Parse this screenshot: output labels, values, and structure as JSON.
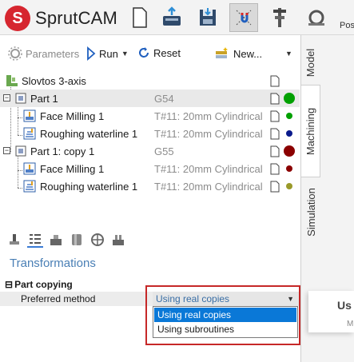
{
  "app": {
    "logo_letter": "S",
    "title": "SprutCAM"
  },
  "toolbar": {
    "icons": [
      "new-document-icon",
      "open-disk-icon",
      "save-icon",
      "magnet-snap-icon",
      "caliper-icon",
      "measure-icon"
    ],
    "pos_label": "Pos"
  },
  "commands": {
    "parameters": "Parameters",
    "run": "Run",
    "reset": "Reset",
    "new": "New..."
  },
  "tree": {
    "root": {
      "name": "Slovtos 3-axis"
    },
    "items": [
      {
        "name": "Part 1",
        "info": "G54",
        "dot_color": "#00a000"
      },
      {
        "name": "Face Milling 1",
        "info": "T#11: 20mm Cylindrical",
        "dot_color": "#00a000"
      },
      {
        "name": "Roughing waterline 1",
        "info": "T#11: 20mm Cylindrical",
        "dot_color": "#0a1a8c"
      },
      {
        "name": "Part 1: copy 1",
        "info": "G55",
        "dot_color": "#8b0000"
      },
      {
        "name": "Face Milling 1",
        "info": "T#11: 20mm Cylindrical",
        "dot_color": "#8b0000"
      },
      {
        "name": "Roughing waterline 1",
        "info": "T#11: 20mm Cylindrical",
        "dot_color": "#9a9a2a"
      }
    ]
  },
  "side_tabs": [
    "Model",
    "Machining",
    "Simulation"
  ],
  "properties": {
    "title": "Transformations",
    "section_toggle": "⊟",
    "section": "Part copying",
    "preferred_label": "Preferred method",
    "selected_value": "Using real copies",
    "options": [
      "Using real copies",
      "Using subroutines"
    ]
  },
  "float_panel": {
    "text1": "Us",
    "text2": "M"
  }
}
